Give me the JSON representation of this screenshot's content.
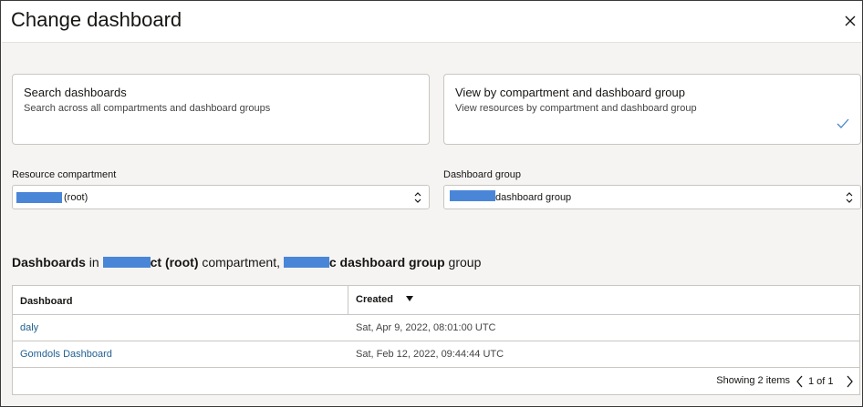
{
  "dialog": {
    "title": "Change dashboard",
    "close_icon": "close-icon"
  },
  "cards": {
    "search": {
      "title": "Search dashboards",
      "description": "Search across all compartments and dashboard groups"
    },
    "view": {
      "title": "View by compartment and dashboard group",
      "description": "View resources by compartment and dashboard group",
      "selected_icon": "checkmark-icon"
    }
  },
  "filters": {
    "compartment_label": "Resource compartment",
    "compartment_value": "(root)",
    "group_label": "Dashboard group",
    "group_value": "dashboard group"
  },
  "section": {
    "prefix": "Dashboards",
    "in": " in ",
    "compartment_name": "ct (root)",
    "compartment_word": " compartment, ",
    "group_name": "c dashboard group",
    "group_word": " group"
  },
  "table": {
    "columns": [
      "Dashboard",
      "Created"
    ],
    "sort_icon": "sort-descending-icon",
    "rows": [
      {
        "name": "daly",
        "created": "Sat, Apr 9, 2022, 08:01:00 UTC"
      },
      {
        "name": "Gomdols Dashboard",
        "created": "Sat, Feb 12, 2022, 09:44:44 UTC"
      }
    ],
    "showing": "Showing 2 items",
    "page": "1 of 1"
  },
  "colors": {
    "link": "#1f5f8f",
    "redaction": "#4a86d8",
    "border": "#c9c6c1",
    "background": "#f5f4f2"
  }
}
